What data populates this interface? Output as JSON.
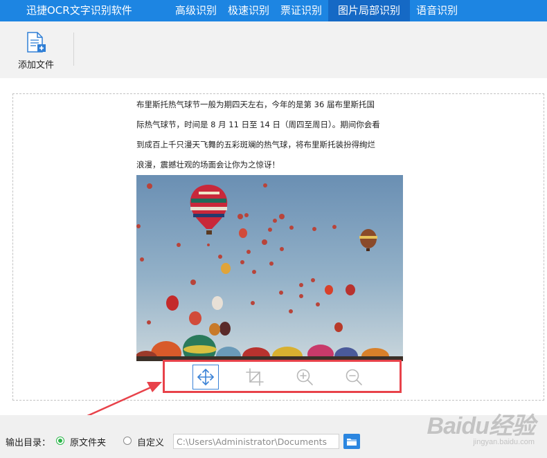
{
  "app": {
    "title": "迅捷OCR文字识别软件"
  },
  "tabs": [
    {
      "label": "高级识别",
      "active": false
    },
    {
      "label": "极速识别",
      "active": false
    },
    {
      "label": "票证识别",
      "active": false
    },
    {
      "label": "图片局部识别",
      "active": true
    },
    {
      "label": "语音识别",
      "active": false
    }
  ],
  "toolbar": {
    "add_file_label": "添加文件",
    "add_file_icon": "document-plus-icon"
  },
  "document": {
    "lines": [
      "布里斯托热气球节一般为期四天左右，今年的是第 36 届布里斯托国",
      "际热气球节，时间是 8 月 11 日至 14 日（周四至周日）。期间你会看",
      "到成百上千只漫天飞舞的五彩斑斓的热气球，将布里斯托装扮得绚烂",
      "浪漫，震撼壮观的场面会让你为之惊讶！"
    ]
  },
  "image_tools": [
    {
      "name": "move-icon",
      "active": true
    },
    {
      "name": "crop-icon",
      "active": false
    },
    {
      "name": "zoom-in-icon",
      "active": false
    },
    {
      "name": "zoom-out-icon",
      "active": false
    }
  ],
  "output": {
    "label": "输出目录：",
    "option_original": "原文件夹",
    "option_custom": "自定义",
    "selected": "original",
    "path_value": "C:\\Users\\Administrator\\Documents",
    "browse_icon": "folder-icon"
  },
  "watermark": {
    "main": "Baidu经验",
    "sub": "jingyan.baidu.com"
  },
  "colors": {
    "topbar": "#1d85e2",
    "tab_active": "#1569c5",
    "highlight_red": "#e8424a",
    "radio_green": "#2bb54a"
  }
}
